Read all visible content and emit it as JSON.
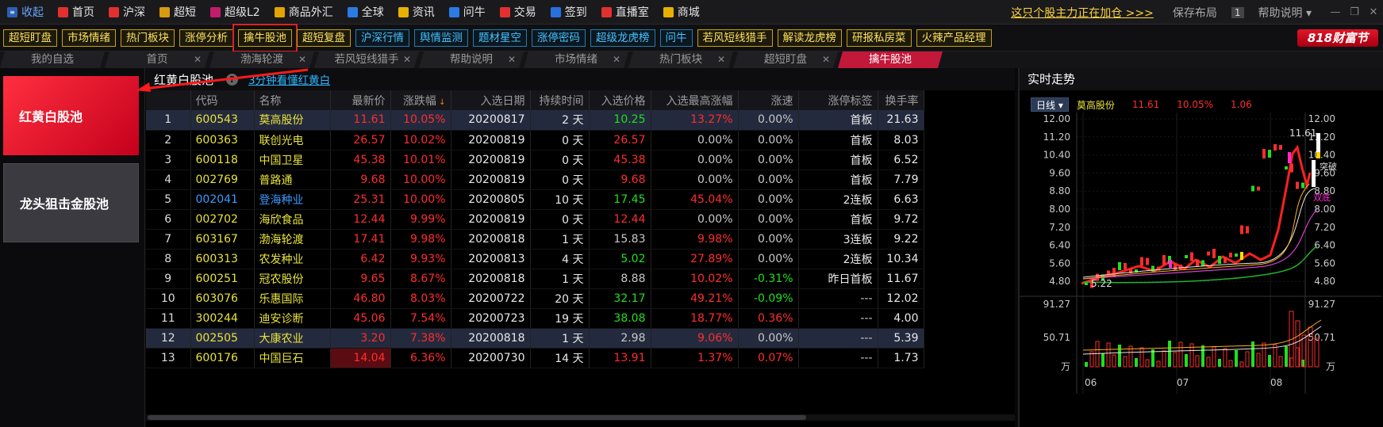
{
  "menu": {
    "collapse": "收起",
    "items": [
      {
        "label": "首页",
        "color": "#e23030",
        "icon": "home-icon"
      },
      {
        "label": "沪深",
        "color": "#e23030",
        "icon": "market-icon"
      },
      {
        "label": "超短",
        "color": "#d89a10",
        "icon": "flash-icon"
      },
      {
        "label": "超级L2",
        "color": "#c21c6a",
        "icon": "l2-icon"
      },
      {
        "label": "商品外汇",
        "color": "#e1a400",
        "icon": "coin-icon"
      },
      {
        "label": "全球",
        "color": "#2a7be4",
        "icon": "globe-icon"
      },
      {
        "label": "资讯",
        "color": "#e8b000",
        "icon": "news-icon"
      },
      {
        "label": "问牛",
        "color": "#2a7be4",
        "icon": "search-icon"
      },
      {
        "label": "交易",
        "color": "#e23030",
        "icon": "trade-icon"
      },
      {
        "label": "签到",
        "color": "#2a6fe0",
        "icon": "checkin-icon"
      },
      {
        "label": "直播室",
        "color": "#e23030",
        "icon": "live-icon"
      },
      {
        "label": "商城",
        "color": "#e8b000",
        "icon": "shop-icon"
      }
    ],
    "promo": "这只个股主力正在加仓 >>>",
    "save_layout": "保存布局",
    "window_num": "1",
    "help": "帮助说明"
  },
  "toolbar": {
    "buttons": [
      {
        "label": "超短盯盘",
        "style": "gold"
      },
      {
        "label": "市场情绪",
        "style": "gold"
      },
      {
        "label": "热门板块",
        "style": "gold"
      },
      {
        "label": "涨停分析",
        "style": "gold"
      },
      {
        "label": "擒牛股池",
        "style": "gold",
        "active": true
      },
      {
        "label": "超短复盘",
        "style": "gold"
      },
      {
        "label": "沪深行情",
        "style": "cyan"
      },
      {
        "label": "舆情监测",
        "style": "cyan"
      },
      {
        "label": "题材星空",
        "style": "cyan"
      },
      {
        "label": "涨停密码",
        "style": "cyan"
      },
      {
        "label": "超级龙虎榜",
        "style": "cyan"
      },
      {
        "label": "问牛",
        "style": "cyan"
      },
      {
        "label": "若风短线猎手",
        "style": "gold"
      },
      {
        "label": "解读龙虎榜",
        "style": "gold"
      },
      {
        "label": "研报私房菜",
        "style": "gold"
      },
      {
        "label": "火辣产品经理",
        "style": "gold"
      }
    ],
    "brand": "818财富节"
  },
  "tabs": [
    {
      "label": "我的自选",
      "active": false,
      "closable": false
    },
    {
      "label": "首页",
      "active": false,
      "closable": true
    },
    {
      "label": "渤海轮渡",
      "active": false,
      "closable": true
    },
    {
      "label": "若风短线猎手",
      "active": false,
      "closable": true
    },
    {
      "label": "帮助说明",
      "active": false,
      "closable": true
    },
    {
      "label": "市场情绪",
      "active": false,
      "closable": true
    },
    {
      "label": "热门板块",
      "active": false,
      "closable": true
    },
    {
      "label": "超短盯盘",
      "active": false,
      "closable": true
    },
    {
      "label": "擒牛股池",
      "active": true,
      "closable": false
    }
  ],
  "left": {
    "btn1": "红黄白股池",
    "btn2": "龙头狙击金股池"
  },
  "pool": {
    "title": "红黄白股池",
    "link": "3分钟看懂红黄白"
  },
  "table": {
    "headers": [
      "",
      "代码",
      "名称",
      "最新价",
      "涨跌幅",
      "入选日期",
      "持续时间",
      "入选价格",
      "入选最高涨幅",
      "涨速",
      "涨停标签",
      "换手率"
    ],
    "rows": [
      {
        "idx": "1",
        "code": "600543",
        "name": "莫高股份",
        "price": "11.61",
        "chg": "10.05%",
        "date": "20200817",
        "dur": "2 天",
        "entry": "10.25",
        "entryc": "dn",
        "maxg": "13.27%",
        "maxc": "up",
        "speed": "0.00%",
        "speedc": "eq",
        "tag": "首板",
        "turn": "21.63",
        "sel": true
      },
      {
        "idx": "2",
        "code": "600363",
        "name": "联创光电",
        "price": "26.57",
        "chg": "10.02%",
        "date": "20200819",
        "dur": "0 天",
        "entry": "26.57",
        "entryc": "up",
        "maxg": "0.00%",
        "maxc": "eq",
        "speed": "0.00%",
        "speedc": "eq",
        "tag": "首板",
        "turn": "8.03"
      },
      {
        "idx": "3",
        "code": "600118",
        "name": "中国卫星",
        "price": "45.38",
        "chg": "10.01%",
        "date": "20200819",
        "dur": "0 天",
        "entry": "45.38",
        "entryc": "up",
        "maxg": "0.00%",
        "maxc": "eq",
        "speed": "0.00%",
        "speedc": "eq",
        "tag": "首板",
        "turn": "6.52"
      },
      {
        "idx": "4",
        "code": "002769",
        "name": "普路通",
        "price": "9.68",
        "chg": "10.00%",
        "date": "20200819",
        "dur": "0 天",
        "entry": "9.68",
        "entryc": "up",
        "maxg": "0.00%",
        "maxc": "eq",
        "speed": "0.00%",
        "speedc": "eq",
        "tag": "首板",
        "turn": "7.79"
      },
      {
        "idx": "5",
        "code": "002041",
        "name": "登海种业",
        "price": "25.31",
        "chg": "10.00%",
        "date": "20200805",
        "dur": "10 天",
        "entry": "17.45",
        "entryc": "dn",
        "maxg": "45.04%",
        "maxc": "up",
        "speed": "0.00%",
        "speedc": "eq",
        "tag": "2连板",
        "turn": "6.63",
        "blue": true
      },
      {
        "idx": "6",
        "code": "002702",
        "name": "海欣食品",
        "price": "12.44",
        "chg": "9.99%",
        "date": "20200819",
        "dur": "0 天",
        "entry": "12.44",
        "entryc": "up",
        "maxg": "0.00%",
        "maxc": "eq",
        "speed": "0.00%",
        "speedc": "eq",
        "tag": "首板",
        "turn": "9.72"
      },
      {
        "idx": "7",
        "code": "603167",
        "name": "渤海轮渡",
        "price": "17.41",
        "chg": "9.98%",
        "date": "20200818",
        "dur": "1 天",
        "entry": "15.83",
        "entryc": "eq",
        "maxg": "9.98%",
        "maxc": "up",
        "speed": "0.00%",
        "speedc": "eq",
        "tag": "3连板",
        "turn": "9.22"
      },
      {
        "idx": "8",
        "code": "600313",
        "name": "农发种业",
        "price": "6.42",
        "chg": "9.93%",
        "date": "20200813",
        "dur": "4 天",
        "entry": "5.02",
        "entryc": "dn",
        "maxg": "27.89%",
        "maxc": "up",
        "speed": "0.00%",
        "speedc": "eq",
        "tag": "2连板",
        "turn": "10.34"
      },
      {
        "idx": "9",
        "code": "600251",
        "name": "冠农股份",
        "price": "9.65",
        "chg": "8.67%",
        "date": "20200818",
        "dur": "1 天",
        "entry": "8.88",
        "entryc": "eq",
        "maxg": "10.02%",
        "maxc": "up",
        "speed": "-0.31%",
        "speedc": "dn",
        "tag": "昨日首板",
        "turn": "11.67"
      },
      {
        "idx": "10",
        "code": "603076",
        "name": "乐惠国际",
        "price": "46.80",
        "chg": "8.03%",
        "date": "20200722",
        "dur": "20 天",
        "entry": "32.17",
        "entryc": "dn",
        "maxg": "49.21%",
        "maxc": "up",
        "speed": "-0.09%",
        "speedc": "dn",
        "tag": "---",
        "turn": "12.02"
      },
      {
        "idx": "11",
        "code": "300244",
        "name": "迪安诊断",
        "price": "45.06",
        "chg": "7.54%",
        "date": "20200723",
        "dur": "19 天",
        "entry": "38.08",
        "entryc": "dn",
        "maxg": "18.77%",
        "maxc": "up",
        "speed": "0.36%",
        "speedc": "up",
        "tag": "---",
        "turn": "4.00"
      },
      {
        "idx": "12",
        "code": "002505",
        "name": "大康农业",
        "price": "3.20",
        "chg": "7.38%",
        "date": "20200818",
        "dur": "1 天",
        "entry": "2.98",
        "entryc": "eq",
        "maxg": "9.06%",
        "maxc": "up",
        "speed": "0.00%",
        "speedc": "eq",
        "tag": "---",
        "turn": "5.39",
        "sel": true
      },
      {
        "idx": "13",
        "code": "600176",
        "name": "中国巨石",
        "price": "14.04",
        "chg": "6.36%",
        "date": "20200730",
        "dur": "14 天",
        "entry": "13.91",
        "entryc": "up",
        "maxg": "1.37%",
        "maxc": "up",
        "speed": "0.07%",
        "speedc": "up",
        "tag": "---",
        "turn": "1.73",
        "hlprice": true
      }
    ]
  },
  "chart": {
    "title": "实时走势",
    "period": "日线",
    "stock": "莫高股份",
    "price": "11.61",
    "chg": "10.05%",
    "diff": "1.06",
    "price_ticks": [
      "12.00",
      "11.20",
      "10.40",
      "9.60",
      "8.80",
      "8.00",
      "7.20",
      "6.40",
      "5.60",
      "4.80"
    ],
    "vol_ticks": [
      "91.27",
      "50.71",
      "万"
    ],
    "months": [
      "06",
      "07",
      "08"
    ],
    "high_label": "11.61",
    "low_label": "5.22",
    "break_label": "突破",
    "dbl_label": "双底",
    "accent_up": "#ff2d2d",
    "accent_dn": "#1ee01e"
  }
}
